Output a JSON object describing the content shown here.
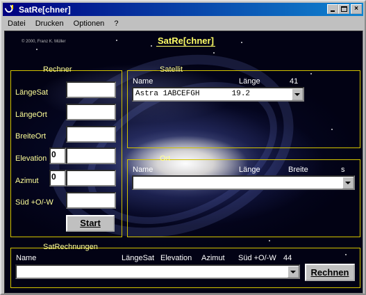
{
  "window": {
    "title": "SatRe[chner]",
    "buttons": {
      "minimize": "minimize",
      "maximize": "maximize",
      "close": "×"
    }
  },
  "menu": {
    "items": [
      {
        "label": "Datei"
      },
      {
        "label": "Drucken"
      },
      {
        "label": "Optionen"
      },
      {
        "label": "?"
      }
    ]
  },
  "header": {
    "copyright": "© 2000, Franz K. Müller",
    "title": "SatRe[chner]"
  },
  "rechner": {
    "legend": "Rechner",
    "fields": [
      {
        "label": "LängeSat",
        "value": ""
      },
      {
        "label": "LängeOrt",
        "value": ""
      },
      {
        "label": "BreiteOrt",
        "value": ""
      },
      {
        "label": "Elevation",
        "value": ""
      },
      {
        "label": "Azimut",
        "value": ""
      },
      {
        "label": "Süd +O/-W",
        "value": ""
      }
    ],
    "elevation_prefix": "0",
    "azimut_prefix": "0",
    "start_button": "Start"
  },
  "satellit": {
    "legend": "Satellit",
    "col_name": "Name",
    "col_laenge": "Länge",
    "count": "41",
    "selected": "Astra 1ABCEFGH       19.2"
  },
  "ort": {
    "legend": "Ort",
    "col_name": "Name",
    "col_laenge": "Länge",
    "col_breite": "Breite",
    "col_s": "s",
    "selected": ""
  },
  "satrechnungen": {
    "legend": "SatRechnungen",
    "col_name": "Name",
    "col_laengesat": "LängeSat",
    "col_elevation": "Elevation",
    "col_azimut": "Azimut",
    "col_sued": "Süd +O/-W",
    "count": "44",
    "selected": "",
    "rechnen_button": "Rechnen"
  },
  "colors": {
    "title_gradient_start": "#000080",
    "title_gradient_end": "#1084d0",
    "label_color": "#ffff99",
    "frame_color": "#d4c400",
    "headline_color": "#ffff66"
  }
}
